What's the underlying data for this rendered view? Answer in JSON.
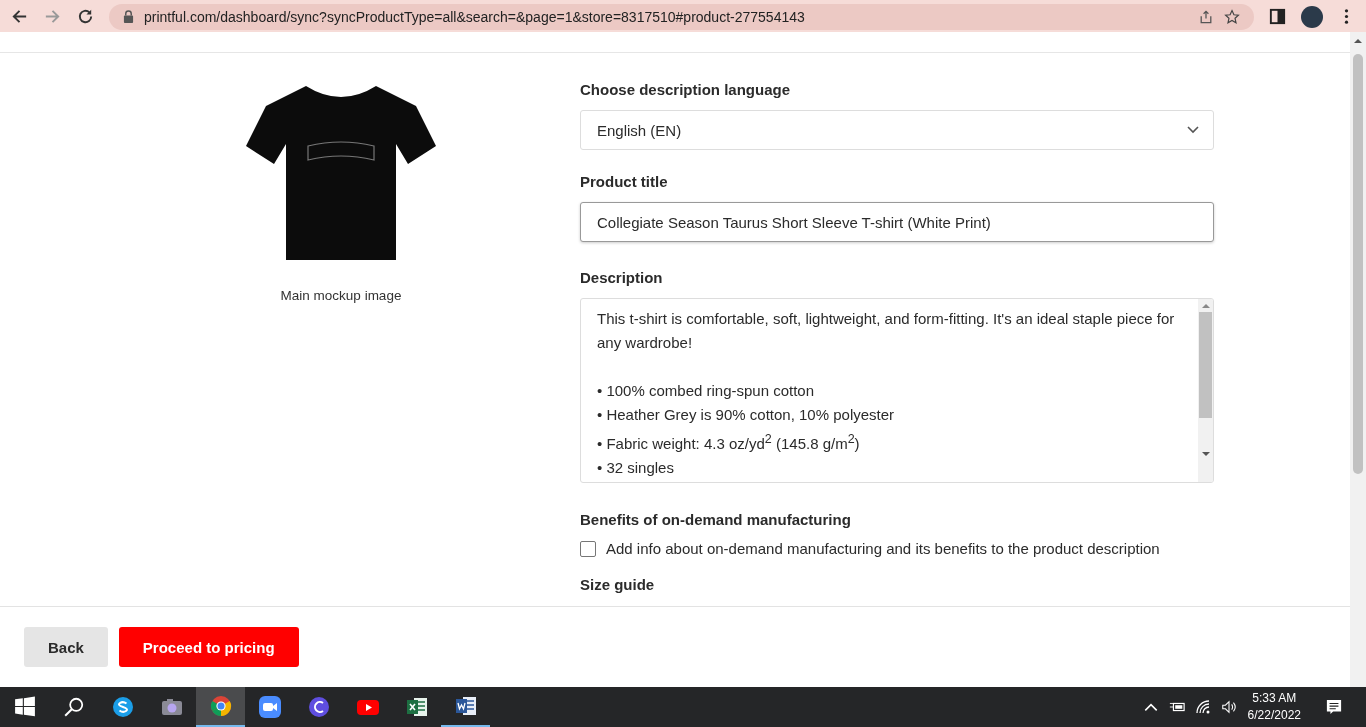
{
  "browser": {
    "url": "printful.com/dashboard/sync?syncProductType=all&search=&page=1&store=8317510#product-277554143"
  },
  "mockup": {
    "caption": "Main mockup image"
  },
  "form": {
    "language": {
      "label": "Choose description language",
      "value": "English (EN)"
    },
    "title": {
      "label": "Product title",
      "value": "Collegiate Season Taurus Short Sleeve T-shirt (White Print)"
    },
    "description": {
      "label": "Description",
      "intro": "This t-shirt is comfortable, soft, lightweight, and form-fitting. It's an ideal staple piece for any wardrobe!",
      "bullets": [
        "• 100% combed ring-spun cotton",
        "• Heather Grey is 90% cotton, 10% polyester",
        "• Fabric weight: 4.3 oz/yd$^{2}$ (145.8 g/m$^{2}$)",
        "• 32 singles"
      ]
    },
    "benefits": {
      "label": "Benefits of on-demand manufacturing",
      "option": "Add info about on-demand manufacturing and its benefits to the product description",
      "checked": false
    },
    "size_guide": {
      "label": "Size guide"
    }
  },
  "footer": {
    "buttons": [
      {
        "label": "Back",
        "kind": "secondary"
      },
      {
        "label": "Proceed to pricing",
        "kind": "primary"
      }
    ]
  },
  "taskbar": {
    "apps": [
      {
        "kind": "skype",
        "selected": false,
        "running": false
      },
      {
        "kind": "camera",
        "selected": false,
        "running": false
      },
      {
        "kind": "chrome",
        "selected": true,
        "running": true
      },
      {
        "kind": "zoom",
        "selected": false,
        "running": false
      },
      {
        "kind": "canva",
        "selected": false,
        "running": false
      },
      {
        "kind": "youtube",
        "selected": false,
        "running": false
      },
      {
        "kind": "excel",
        "selected": false,
        "running": false
      },
      {
        "kind": "word",
        "selected": false,
        "running": true
      }
    ],
    "time": "5:33 AM",
    "date": "6/22/2022"
  }
}
